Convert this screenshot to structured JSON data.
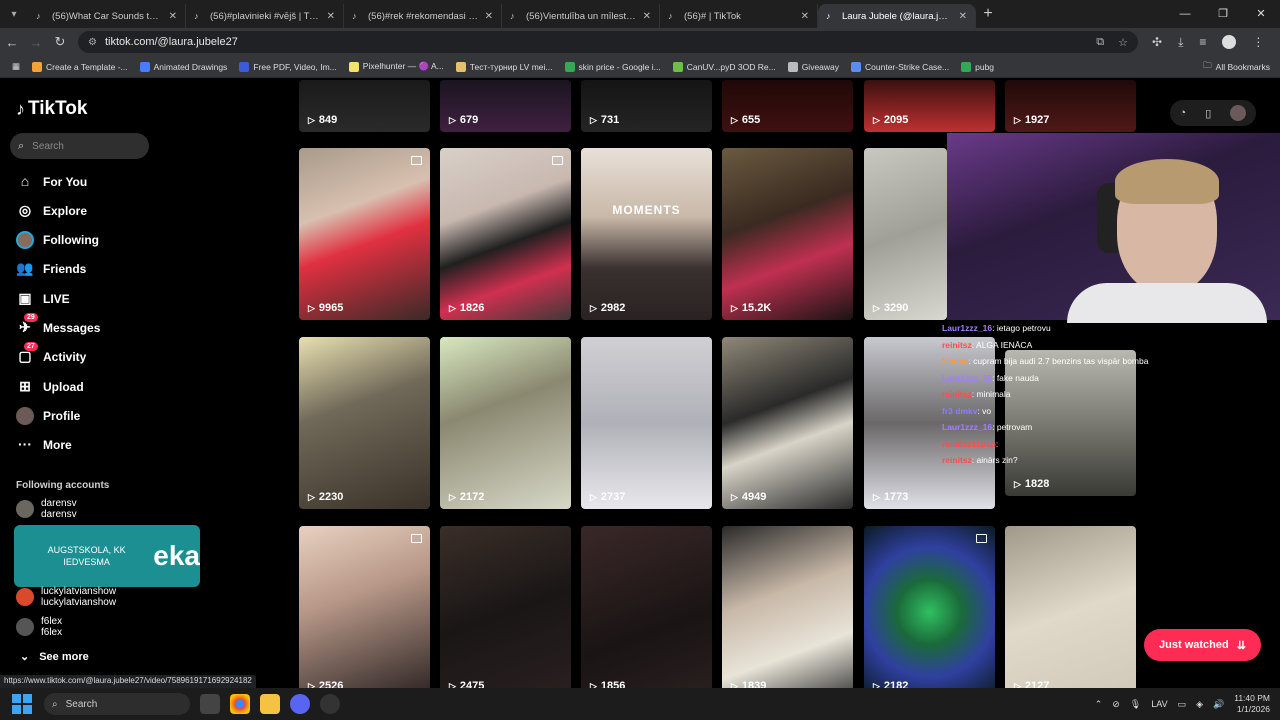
{
  "browser": {
    "tabs": [
      {
        "label": "(56)What Car Sounds the Best:",
        "active": false
      },
      {
        "label": "(56)#plavinieki #vējš | TikTok",
        "active": false
      },
      {
        "label": "(56)#rek #rekomendasi #on #fy",
        "active": false
      },
      {
        "label": "(56)Vientulība un mīlestība: kā",
        "active": false
      },
      {
        "label": "(56)# | TikTok",
        "active": false
      },
      {
        "label": "Laura Jubele (@laura.jubele27)",
        "active": true
      }
    ],
    "url": "tiktok.com/@laura.jubele27",
    "bookmarks": [
      {
        "label": "Create a Template -...",
        "color": "#f4a236"
      },
      {
        "label": "Animated Drawings",
        "color": "#4a7bff"
      },
      {
        "label": "Free PDF, Video, Im...",
        "color": "#3b5bdb"
      },
      {
        "label": "Pixelhunter — 🟣 A...",
        "color": "#f5e26a"
      },
      {
        "label": "Тест-турнир LV mei...",
        "color": "#e2c36b"
      },
      {
        "label": "skin price - Google i...",
        "color": "#34a853"
      },
      {
        "label": "CanUV...pyD 3OD Re...",
        "color": "#6cc04a"
      },
      {
        "label": "Giveaway",
        "color": "#bbbbbb"
      },
      {
        "label": "Counter-Strike Case...",
        "color": "#5b8def"
      },
      {
        "label": "pubg",
        "color": "#34a853"
      }
    ],
    "all_bookmarks": "All Bookmarks",
    "status_url": "https://www.tiktok.com/@laura.jubele27/video/7589619171692924182"
  },
  "sidebar": {
    "logo": "TikTok",
    "search_placeholder": "Search",
    "nav": [
      {
        "label": "For You",
        "icon": "home-icon"
      },
      {
        "label": "Explore",
        "icon": "compass-icon"
      },
      {
        "label": "Following",
        "icon": "following-avatar-icon"
      },
      {
        "label": "Friends",
        "icon": "friends-icon"
      },
      {
        "label": "LIVE",
        "icon": "live-icon"
      },
      {
        "label": "Messages",
        "icon": "messages-icon",
        "badge": "29"
      },
      {
        "label": "Activity",
        "icon": "activity-icon",
        "badge": "27"
      },
      {
        "label": "Upload",
        "icon": "upload-icon"
      },
      {
        "label": "Profile",
        "icon": "profile-avatar-icon"
      },
      {
        "label": "More",
        "icon": "more-icon"
      }
    ],
    "following_title": "Following accounts",
    "following": [
      {
        "name": "darensv",
        "handle": "darensv"
      },
      {
        "name": "luckylatvianshow",
        "handle": "luckylatvianshow"
      },
      {
        "name": "f6lex",
        "handle": "f6lex"
      }
    ],
    "overlay_left": "AUGSTSKOLA, KK IEDVESMA",
    "overlay_right": "eka",
    "see_more": "See more"
  },
  "grid": {
    "row0": [
      "849",
      "679",
      "731",
      "655",
      "2095",
      "1927"
    ],
    "row1": [
      "9965",
      "1826",
      "2982",
      "15.2K",
      "3290"
    ],
    "row2": [
      "2230",
      "2172",
      "2737",
      "4949",
      "1773",
      "1828"
    ],
    "row3": [
      "2526",
      "2475",
      "1856",
      "1839",
      "2182",
      "2127"
    ],
    "moments_text": "MOMENTS"
  },
  "chat": [
    {
      "name": "Laur1zzz_16",
      "color": "#a47cff",
      "msg": ": ietago petrovu"
    },
    {
      "name": "reinitsz",
      "color": "#ff4c4c",
      "msg": ": ALGA IENĀCA"
    },
    {
      "name": "Koupe",
      "color": "#ff9933",
      "msg": ": cupram bija audi 2.7 benzins tas vispār bomba"
    },
    {
      "name": "Laur1zzz_16",
      "color": "#a47cff",
      "msg": ": fake nauda"
    },
    {
      "name": "reinitsz",
      "color": "#ff4c4c",
      "msg": ": minimala"
    },
    {
      "name": "fr3 dmkv",
      "color": "#8c7cff",
      "msg": ": vo"
    },
    {
      "name": "Laur1zzz_16",
      "color": "#a47cff",
      "msg": ": petrovam"
    },
    {
      "name": "reinitsz11pap",
      "color": "#ff4c4c",
      "msg": ":"
    },
    {
      "name": "reinitsz",
      "color": "#ff4c4c",
      "msg": ": ainārs zin?"
    }
  ],
  "just_watched": "Just watched",
  "taskbar": {
    "search_placeholder": "Search",
    "lang": "LAV",
    "time": "11:40 PM",
    "date": "1/1/2026"
  }
}
